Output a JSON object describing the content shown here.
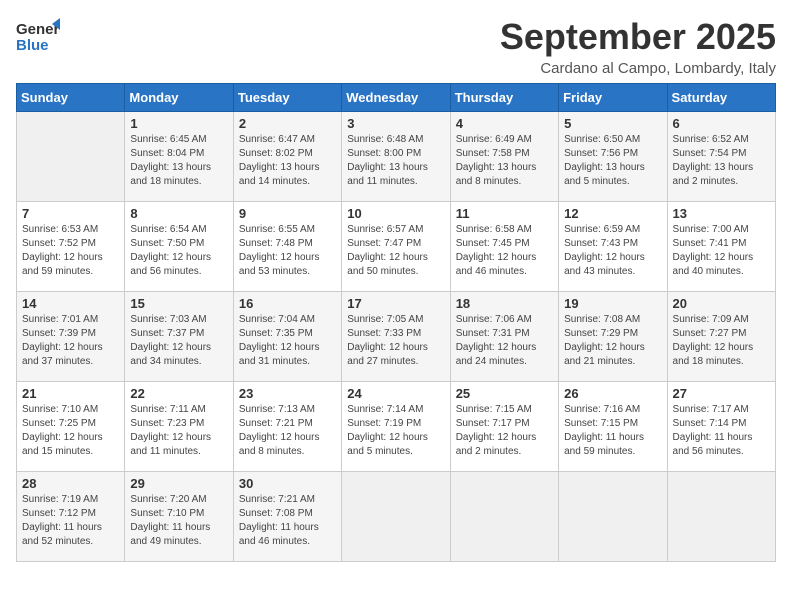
{
  "logo": {
    "line1": "General",
    "line2": "Blue"
  },
  "title": "September 2025",
  "location": "Cardano al Campo, Lombardy, Italy",
  "days_of_week": [
    "Sunday",
    "Monday",
    "Tuesday",
    "Wednesday",
    "Thursday",
    "Friday",
    "Saturday"
  ],
  "weeks": [
    [
      {
        "day": "",
        "info": ""
      },
      {
        "day": "1",
        "info": "Sunrise: 6:45 AM\nSunset: 8:04 PM\nDaylight: 13 hours\nand 18 minutes."
      },
      {
        "day": "2",
        "info": "Sunrise: 6:47 AM\nSunset: 8:02 PM\nDaylight: 13 hours\nand 14 minutes."
      },
      {
        "day": "3",
        "info": "Sunrise: 6:48 AM\nSunset: 8:00 PM\nDaylight: 13 hours\nand 11 minutes."
      },
      {
        "day": "4",
        "info": "Sunrise: 6:49 AM\nSunset: 7:58 PM\nDaylight: 13 hours\nand 8 minutes."
      },
      {
        "day": "5",
        "info": "Sunrise: 6:50 AM\nSunset: 7:56 PM\nDaylight: 13 hours\nand 5 minutes."
      },
      {
        "day": "6",
        "info": "Sunrise: 6:52 AM\nSunset: 7:54 PM\nDaylight: 13 hours\nand 2 minutes."
      }
    ],
    [
      {
        "day": "7",
        "info": "Sunrise: 6:53 AM\nSunset: 7:52 PM\nDaylight: 12 hours\nand 59 minutes."
      },
      {
        "day": "8",
        "info": "Sunrise: 6:54 AM\nSunset: 7:50 PM\nDaylight: 12 hours\nand 56 minutes."
      },
      {
        "day": "9",
        "info": "Sunrise: 6:55 AM\nSunset: 7:48 PM\nDaylight: 12 hours\nand 53 minutes."
      },
      {
        "day": "10",
        "info": "Sunrise: 6:57 AM\nSunset: 7:47 PM\nDaylight: 12 hours\nand 50 minutes."
      },
      {
        "day": "11",
        "info": "Sunrise: 6:58 AM\nSunset: 7:45 PM\nDaylight: 12 hours\nand 46 minutes."
      },
      {
        "day": "12",
        "info": "Sunrise: 6:59 AM\nSunset: 7:43 PM\nDaylight: 12 hours\nand 43 minutes."
      },
      {
        "day": "13",
        "info": "Sunrise: 7:00 AM\nSunset: 7:41 PM\nDaylight: 12 hours\nand 40 minutes."
      }
    ],
    [
      {
        "day": "14",
        "info": "Sunrise: 7:01 AM\nSunset: 7:39 PM\nDaylight: 12 hours\nand 37 minutes."
      },
      {
        "day": "15",
        "info": "Sunrise: 7:03 AM\nSunset: 7:37 PM\nDaylight: 12 hours\nand 34 minutes."
      },
      {
        "day": "16",
        "info": "Sunrise: 7:04 AM\nSunset: 7:35 PM\nDaylight: 12 hours\nand 31 minutes."
      },
      {
        "day": "17",
        "info": "Sunrise: 7:05 AM\nSunset: 7:33 PM\nDaylight: 12 hours\nand 27 minutes."
      },
      {
        "day": "18",
        "info": "Sunrise: 7:06 AM\nSunset: 7:31 PM\nDaylight: 12 hours\nand 24 minutes."
      },
      {
        "day": "19",
        "info": "Sunrise: 7:08 AM\nSunset: 7:29 PM\nDaylight: 12 hours\nand 21 minutes."
      },
      {
        "day": "20",
        "info": "Sunrise: 7:09 AM\nSunset: 7:27 PM\nDaylight: 12 hours\nand 18 minutes."
      }
    ],
    [
      {
        "day": "21",
        "info": "Sunrise: 7:10 AM\nSunset: 7:25 PM\nDaylight: 12 hours\nand 15 minutes."
      },
      {
        "day": "22",
        "info": "Sunrise: 7:11 AM\nSunset: 7:23 PM\nDaylight: 12 hours\nand 11 minutes."
      },
      {
        "day": "23",
        "info": "Sunrise: 7:13 AM\nSunset: 7:21 PM\nDaylight: 12 hours\nand 8 minutes."
      },
      {
        "day": "24",
        "info": "Sunrise: 7:14 AM\nSunset: 7:19 PM\nDaylight: 12 hours\nand 5 minutes."
      },
      {
        "day": "25",
        "info": "Sunrise: 7:15 AM\nSunset: 7:17 PM\nDaylight: 12 hours\nand 2 minutes."
      },
      {
        "day": "26",
        "info": "Sunrise: 7:16 AM\nSunset: 7:15 PM\nDaylight: 11 hours\nand 59 minutes."
      },
      {
        "day": "27",
        "info": "Sunrise: 7:17 AM\nSunset: 7:14 PM\nDaylight: 11 hours\nand 56 minutes."
      }
    ],
    [
      {
        "day": "28",
        "info": "Sunrise: 7:19 AM\nSunset: 7:12 PM\nDaylight: 11 hours\nand 52 minutes."
      },
      {
        "day": "29",
        "info": "Sunrise: 7:20 AM\nSunset: 7:10 PM\nDaylight: 11 hours\nand 49 minutes."
      },
      {
        "day": "30",
        "info": "Sunrise: 7:21 AM\nSunset: 7:08 PM\nDaylight: 11 hours\nand 46 minutes."
      },
      {
        "day": "",
        "info": ""
      },
      {
        "day": "",
        "info": ""
      },
      {
        "day": "",
        "info": ""
      },
      {
        "day": "",
        "info": ""
      }
    ]
  ]
}
